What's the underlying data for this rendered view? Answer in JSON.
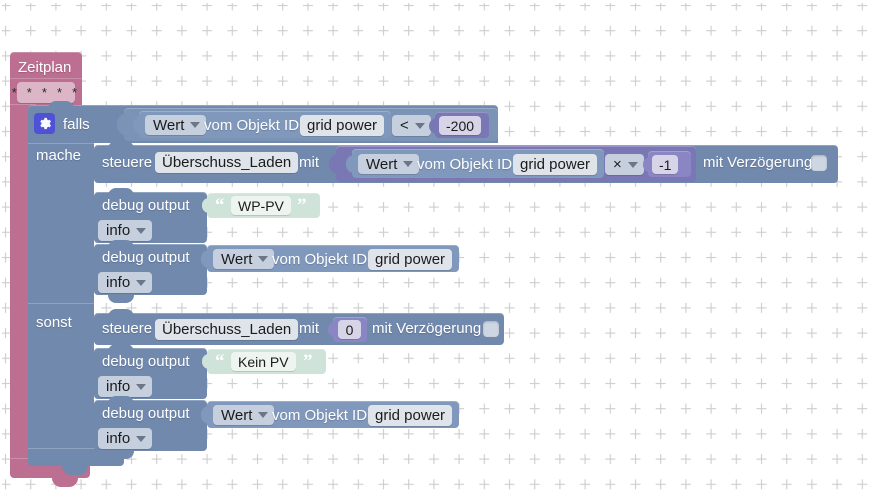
{
  "editor": {
    "name": "blockly-workspace",
    "background": "#ffffff",
    "grid_color": "#cccccc"
  },
  "colors": {
    "schedule": "#bc6f91",
    "control": "#7189ad",
    "math": "#7a77b5",
    "text": "#cfe3d8",
    "field": "#dfe3ea",
    "dropdown": "#c6cfdd",
    "gear": "#4f51d6"
  },
  "schedule_block": {
    "title": "Zeitplan",
    "cron_value": "* * * * *"
  },
  "if_block": {
    "gear_icon": "gear-icon",
    "if_label": "falls",
    "do_label": "mache",
    "else_label": "sonst"
  },
  "condition": {
    "value_dropdown": "Wert",
    "label": "vom Objekt ID",
    "object_id": "grid power",
    "operator": "<",
    "compare_value": "-200"
  },
  "then_branch": {
    "control": {
      "verb": "steuere",
      "target": "Überschuss_Laden",
      "with_label": "mit",
      "delay_label": "mit Verzögerung",
      "delay_checked": false,
      "math": {
        "value_dropdown": "Wert",
        "label": "vom Objekt ID",
        "object_id": "grid power",
        "operator": "×",
        "factor": "-1"
      }
    },
    "debug_text": {
      "verb": "debug output",
      "severity": "info",
      "open_quote": "“",
      "close_quote": "”",
      "text": "WP-PV"
    },
    "debug_value": {
      "verb": "debug output",
      "severity": "info",
      "value_dropdown": "Wert",
      "label": "vom Objekt ID",
      "object_id": "grid power"
    }
  },
  "else_branch": {
    "control": {
      "verb": "steuere",
      "target": "Überschuss_Laden",
      "with_label": "mit",
      "value": "0",
      "delay_label": "mit Verzögerung",
      "delay_checked": false
    },
    "debug_text": {
      "verb": "debug output",
      "severity": "info",
      "open_quote": "“",
      "close_quote": "”",
      "text": "Kein PV"
    },
    "debug_value": {
      "verb": "debug output",
      "severity": "info",
      "value_dropdown": "Wert",
      "label": "vom Objekt ID",
      "object_id": "grid power"
    }
  }
}
